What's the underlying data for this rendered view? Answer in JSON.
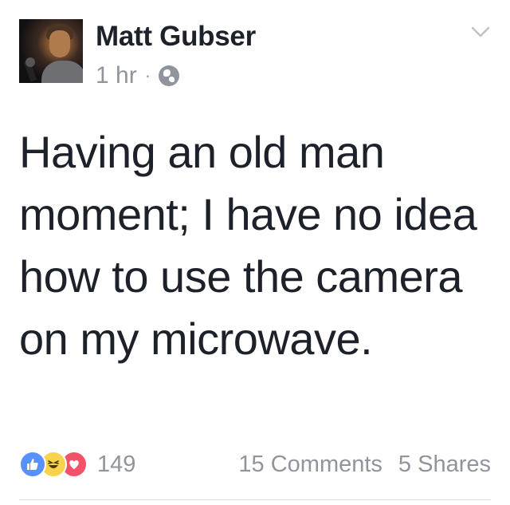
{
  "post": {
    "author": "Matt Gubser",
    "time": "1 hr",
    "separator": "·",
    "privacy_icon": "globe-icon",
    "menu_icon": "chevron-down-icon",
    "text": "Having an old man moment; I have no idea how to use the camera on my microwave."
  },
  "reactions": {
    "icons": [
      "like-icon",
      "haha-icon",
      "love-icon"
    ],
    "count": "149"
  },
  "stats": {
    "comments": "15 Comments",
    "shares": "5 Shares"
  },
  "colors": {
    "text": "#1d2129",
    "muted": "#90949c",
    "like": "#5890ff",
    "haha": "#f7d24c",
    "love": "#f25268"
  }
}
